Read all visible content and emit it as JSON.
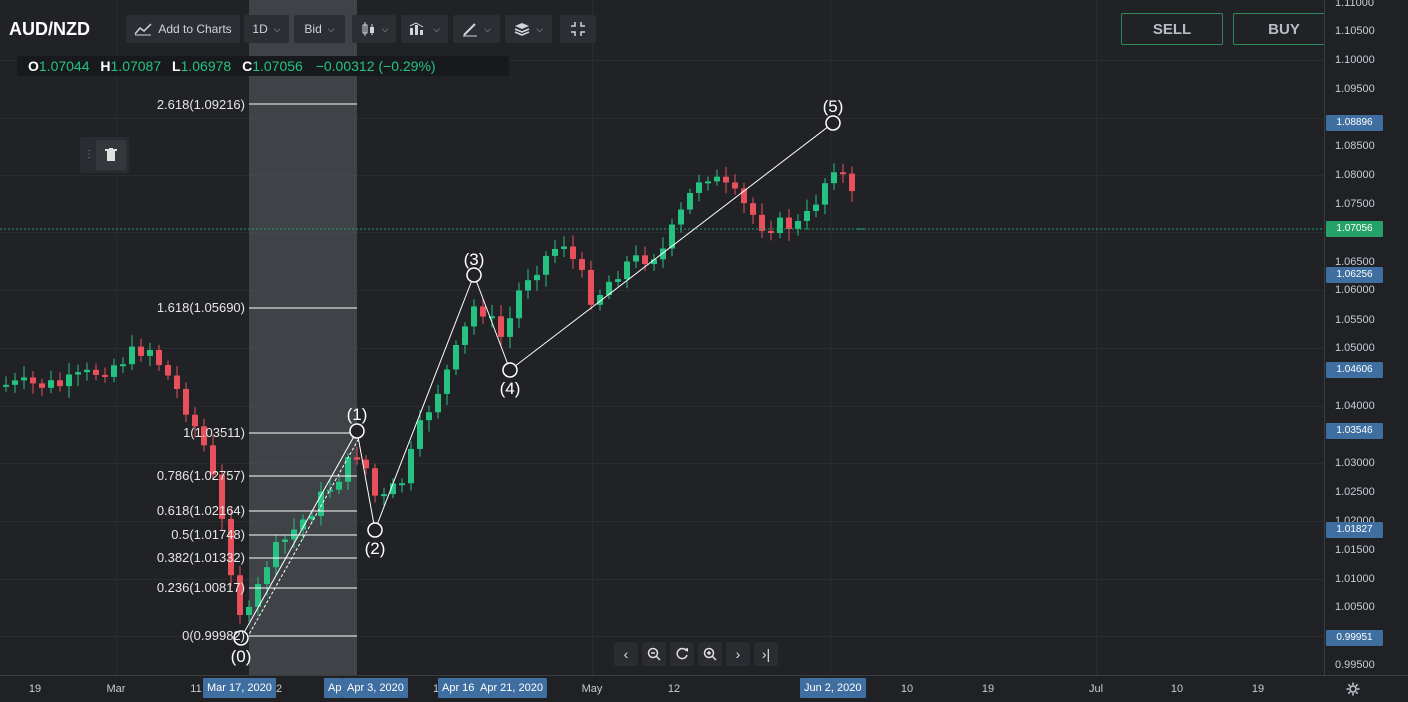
{
  "symbol": "AUD/NZD",
  "toolbar": {
    "add_to_charts": "Add to Charts",
    "interval": "1D",
    "price_type": "Bid"
  },
  "ohlc": {
    "o_label": "O",
    "o": "1.07044",
    "h_label": "H",
    "h": "1.07087",
    "l_label": "L",
    "l": "1.06978",
    "c_label": "C",
    "c": "1.07056",
    "change": "−0.00312 (−0.29%)"
  },
  "trade": {
    "sell": "SELL",
    "buy": "BUY"
  },
  "price_ticks": [
    "1.11000",
    "1.10500",
    "1.10000",
    "1.09500",
    "1.08500",
    "1.08000",
    "1.07500",
    "1.06500",
    "1.06000",
    "1.05500",
    "1.05000",
    "1.04000",
    "1.03000",
    "1.02500",
    "1.02000",
    "1.01500",
    "1.01000",
    "1.00500",
    "0.99500"
  ],
  "price_tags": [
    {
      "text": "1.08896",
      "color": "#3f6fa0"
    },
    {
      "text": "1.07056",
      "color": "#26a269"
    },
    {
      "text": "1.06256",
      "color": "#3f6fa0"
    },
    {
      "text": "1.04606",
      "color": "#3f6fa0"
    },
    {
      "text": "1.03546",
      "color": "#3f6fa0"
    },
    {
      "text": "1.01827",
      "color": "#3f6fa0"
    },
    {
      "text": "0.99951",
      "color": "#3f6fa0"
    }
  ],
  "time_ticks": [
    "19",
    "Mar",
    "11",
    "2",
    "1",
    "May",
    "12",
    "10",
    "19",
    "Jul",
    "10",
    "19"
  ],
  "time_tags": [
    "Mar 17, 2020",
    "Ap",
    "Apr 3, 2020",
    "Apr 16",
    "Apr 21, 2020",
    "Jun 2, 2020"
  ],
  "fib_levels": [
    {
      "label": "2.618(1.09216)"
    },
    {
      "label": "1.618(1.05690)"
    },
    {
      "label": "1(1.03511)"
    },
    {
      "label": "0.786(1.02757)"
    },
    {
      "label": "0.618(1.02164)"
    },
    {
      "label": "0.5(1.01748)"
    },
    {
      "label": "0.382(1.01332)"
    },
    {
      "label": "0.236(1.00817)"
    },
    {
      "label": "0(0.99982)"
    }
  ],
  "waves": [
    "(0)",
    "(1)",
    "(2)",
    "(3)",
    "(4)",
    "(5)"
  ],
  "colors": {
    "up": "#26c281",
    "down": "#e8505b",
    "accent": "#3f6fa0",
    "last_price": "#26a269"
  }
}
